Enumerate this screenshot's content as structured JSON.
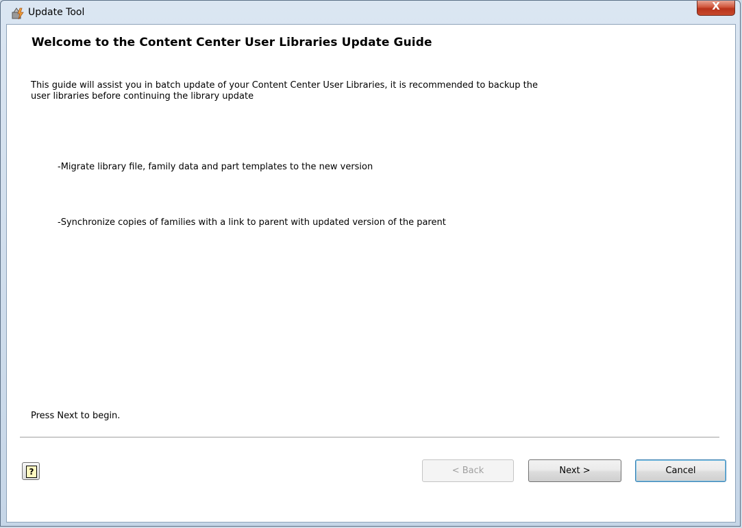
{
  "window": {
    "title": "Update Tool",
    "close_label": "X"
  },
  "content": {
    "heading": "Welcome to the Content Center User Libraries Update Guide",
    "intro_line1": "This guide will assist you in batch update of your Content Center User Libraries, it is recommended to backup the",
    "intro_line2": "user libraries before continuing the library update",
    "bullets": [
      "-Migrate library file, family data and part templates to the new version",
      "-Synchronize copies of families with a link to parent with updated version of the parent"
    ],
    "press_next": "Press Next to begin."
  },
  "footer": {
    "help_label": "?",
    "back_label": "< Back",
    "next_label": "Next >",
    "cancel_label": "Cancel"
  }
}
